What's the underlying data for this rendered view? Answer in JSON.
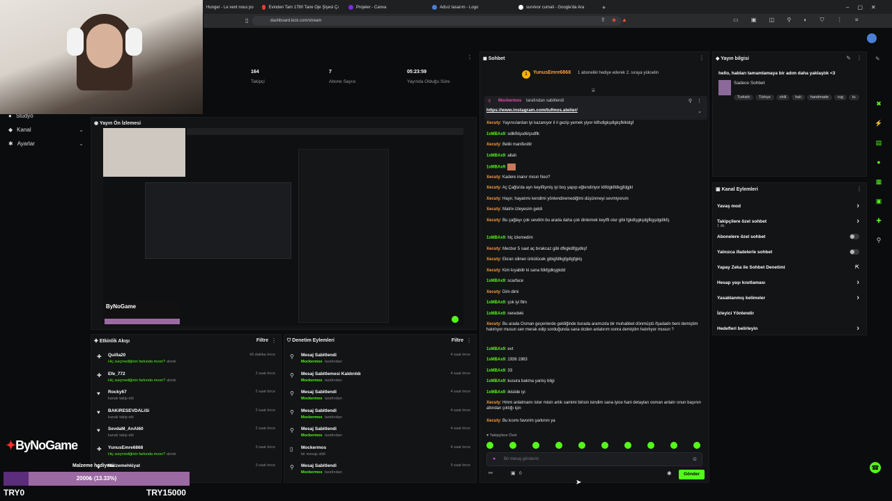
{
  "browser": {
    "tabs": [
      "Hunger - Le vent nous po",
      "Evinden Tam 1780 Tane Oje Şişesi Çı",
      "Projeler - Canva",
      "Adsız tasarım - Logo",
      "survivor cumali - Google'da Ara"
    ],
    "url": "dashboard.kick.com/stream"
  },
  "stats": [
    {
      "value": "164",
      "label": "Takipçi"
    },
    {
      "value": "7",
      "label": "Abone Sayısı"
    },
    {
      "value": "05:23:59",
      "label": "Yayında Olduğu Süre"
    }
  ],
  "nav": {
    "items": [
      "Stüdyo",
      "Kanal",
      "Ayarlar"
    ]
  },
  "preview": {
    "title": "Yayın Ön İzlemesi",
    "brand": "ByNoGame"
  },
  "activity": {
    "title": "Etkinlik Akışı",
    "filter": "Filtre",
    "rows": [
      {
        "name": "Quilla20",
        "sub": "Hiç suiçmediğinin farkında mısın?",
        "suffix": "alındı",
        "time": "43 dakika önce"
      },
      {
        "name": "Efe_772",
        "sub": "Hiç suiçmediğinin farkında mısın?",
        "suffix": "alındı",
        "time": "2 saat önce"
      },
      {
        "name": "Rocky67",
        "sub": "kanalı takip etti",
        "suffix": "",
        "time": "2 saat önce"
      },
      {
        "name": "BAKiRESEVDALiSi",
        "sub": "kanalı takip etti",
        "suffix": "",
        "time": "2 saat önce"
      },
      {
        "name": "SevdaM_AnAl60",
        "sub": "kanalı takip etti",
        "suffix": "",
        "time": "2 saat önce"
      },
      {
        "name": "YunusEmre6868",
        "sub": "Hiç suiçmediğinin farkında mısın?",
        "suffix": "alındı",
        "time": "3 saat önce"
      },
      {
        "name": "Malzemehkiyat",
        "sub": "",
        "suffix": "",
        "time": "3 saat önce"
      }
    ]
  },
  "moderation": {
    "title": "Denetim Eylemleri",
    "filter": "Filtre",
    "rows": [
      {
        "name": "Mesaj Sabitlendi",
        "user": "Mockermos",
        "sub": "tarafından",
        "time": "4 saat önce"
      },
      {
        "name": "Mesaj Sabitlemesi Kaldırıldı",
        "user": "Mockermos",
        "sub": "tarafından",
        "time": "4 saat önce"
      },
      {
        "name": "Mesaj Sabitlendi",
        "user": "Mockermos",
        "sub": "tarafından",
        "time": "4 saat önce"
      },
      {
        "name": "Mesaj Sabitlendi",
        "user": "Mockermos",
        "sub": "tarafından",
        "time": "4 saat önce"
      },
      {
        "name": "Mesaj Sabitlendi",
        "user": "Mockermos",
        "sub": "tarafından",
        "time": "4 saat önce"
      },
      {
        "name": "Mockermos",
        "user": "",
        "sub": "bir mesajı sildi",
        "time": "4 saat önce"
      },
      {
        "name": "Mesaj Sabitlendi",
        "user": "Mockermos",
        "sub": "tarafından",
        "time": "5 saat önce"
      }
    ]
  },
  "chat": {
    "title": "Sohbet",
    "gift_user": "YunusEmre6868",
    "gift_text": "1 aboneliki hediye ederek 2. sıraya yükselin",
    "pinned_by": "Mockermos",
    "pinned_suffix": "tarafından sabitlendi",
    "pinned_link": "https://www.instagram.com/tufmos.atelier/",
    "messages": [
      {
        "u": "Xecuty",
        "t": "Yayıncılardan iyi kazanıyor il il gezip yemek yiyor kllfsdlgkşdlgkşfklkldgf"
      },
      {
        "u": "1xMBAx9",
        "t": "sdlkfklşsdklşsdflk"
      },
      {
        "u": "Xecuty",
        "t": "Belki manifesttir"
      },
      {
        "u": "1xMBAx9",
        "t": "allah"
      },
      {
        "u": "1xMBAx9",
        "t": ""
      },
      {
        "u": "Xecuty",
        "t": "Kadere inanır mısın Neo?"
      },
      {
        "u": "Xecuty",
        "t": "Aç Çağla'da ayrı keyifliymiş iyi boş yapıp eğlendiriyor kllfdgklfdkgjfdgjkl"
      },
      {
        "u": "Xecuty",
        "t": "Hayır, hayatımı kendimi yönlendiremediğimi düşünmeyi sevmiyorum"
      },
      {
        "u": "Xecuty",
        "t": "Matrix izleyesim geldi"
      },
      {
        "u": "Xecuty",
        "t": "Bu çağlayı çok sevdim bu arada daha çok dinlemek keyifli olur gibi fgkdlşgkşdgfkgşdgdlkfş"
      },
      {
        "u": "1xMBAx9",
        "t": "hiç izlemedim"
      },
      {
        "u": "Xecuty",
        "t": "Mecbur 5 saat aç bırakcaz gibi dfkgkdlfgşdkşf"
      },
      {
        "u": "Xecuty",
        "t": "Ekran silinen ürkütücek gibigfdlkgfgdlgfgklş"
      },
      {
        "u": "Xecuty",
        "t": "Kim kıyabilir ki sana fdkfgdkşgkdd"
      },
      {
        "u": "1xMBAx9",
        "t": "scarface"
      },
      {
        "u": "Xecuty",
        "t": "Dim dimi"
      },
      {
        "u": "1xMBAx9",
        "t": "çok iyi film"
      },
      {
        "u": "1xMBAx9",
        "t": "neredeki"
      },
      {
        "u": "Xecuty",
        "t": "Bu arada Osman geçenlerde geldiğinde burada aramızda bir muhabbet dönmüştü ifşadadn beni demiştim hatırlıyor musun sen merak edip sorduğunda sana dcden anlatırım sonra demiştim hatırlıyor musun ?"
      },
      {
        "u": "1xMBAx9",
        "t": "evt"
      },
      {
        "u": "1xMBAx9",
        "t": "1936 1983"
      },
      {
        "u": "1xMBAx9",
        "t": "33"
      },
      {
        "u": "1xMBAx9",
        "t": "kusura bakma yanlış bilgi"
      },
      {
        "u": "1xMBAx9",
        "t": "ikisiide iyi"
      },
      {
        "u": "Xecuty",
        "t": "Hmm anlatmamı ister misin artık samimi birisin isindim sana iyice hani detayları osman anlatır onun başının altından çıktığı için"
      },
      {
        "u": "Xecuty",
        "t": "Bu kısmı favorim şarkının ya"
      }
    ],
    "followers_only": "Takipçilere Özel",
    "input_placeholder": "Bir mesaj gönderin",
    "counter": "0",
    "send_label": "Gönder"
  },
  "stream_info": {
    "title": "Yayın bilgisi",
    "stream_title": "hello, habları tamamlamaya bir adım daha yaklaştık <3",
    "category": "Sadece Sohbet",
    "tags": [
      "Turkish",
      "Türkçe",
      "chill",
      "halı",
      "handmade",
      "rug",
      "tu"
    ]
  },
  "channel_actions": {
    "title": "Kanal Eylemleri",
    "items": [
      {
        "label": "Yavaş mod",
        "sub": "",
        "ctrl": "chevron"
      },
      {
        "label": "Takipçilere özel sohbet",
        "sub": "1 dk.",
        "ctrl": "chevron"
      },
      {
        "label": "Abonelere özel sohbet",
        "sub": "",
        "ctrl": "toggle"
      },
      {
        "label": "Yalnızca ifadelerle sohbet",
        "sub": "",
        "ctrl": "toggle"
      },
      {
        "label": "Yapay Zeka ile Sohbet Denetimi",
        "sub": "",
        "ctrl": "ext"
      },
      {
        "label": "Hesap yaşı kısıtlaması",
        "sub": "",
        "ctrl": "chevron"
      },
      {
        "label": "Yasaklanmış kelimeler",
        "sub": "",
        "ctrl": "chevron"
      },
      {
        "label": "İzleyici Yönlendir",
        "sub": "",
        "ctrl": ""
      },
      {
        "label": "Hedefleri belirleyin",
        "sub": "",
        "ctrl": "chevron"
      }
    ]
  },
  "overlay": {
    "brand": "ByNoGame",
    "goal_label": "Malzeme hediyesi",
    "goal_amount": "2000₺ (13.33%)",
    "progress": 0.1333,
    "min": "TRY0",
    "max": "TRY15000"
  },
  "colors": {
    "accent": "#53fc18",
    "username_orange": "#ff9d3c",
    "bg": "#0b0c0d",
    "panel": "#131416"
  }
}
